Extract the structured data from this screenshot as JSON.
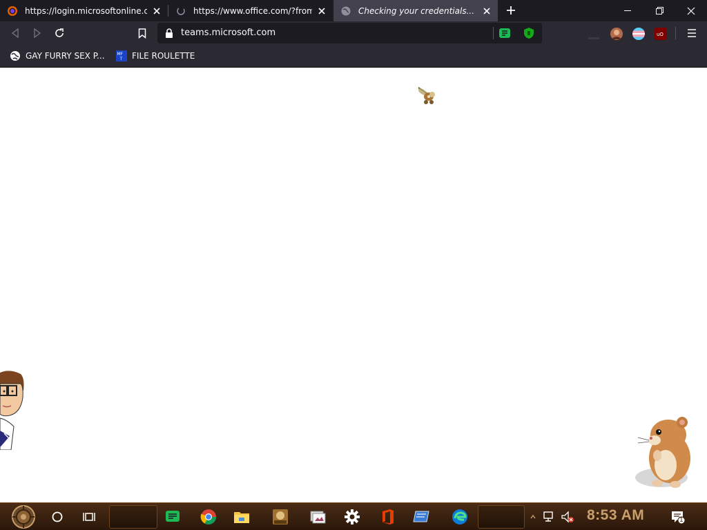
{
  "browser": {
    "tabs": [
      {
        "title": "https://login.microsoftonline.com",
        "active": false,
        "favicon": "firefox-icon"
      },
      {
        "title": "https://www.office.com/?from=",
        "active": false,
        "favicon": "loading-icon"
      },
      {
        "title": "Checking your credentials...",
        "active": true,
        "favicon": "globe-icon"
      }
    ],
    "address": "teams.microsoft.com"
  },
  "bookmarks": [
    {
      "label": "GAY FURRY SEX P...",
      "icon": "globe-icon"
    },
    {
      "label": "FILE ROULETTE",
      "icon": "mft-icon"
    }
  ],
  "taskbar": {
    "pinned": [
      "start-orb",
      "cortana-circle",
      "task-view",
      "spotify",
      "chrome",
      "file-explorer",
      "game-app",
      "image-viewer",
      "settings",
      "office",
      "remote-desktop",
      "edge"
    ],
    "clock": "8:53 AM",
    "notification_count": "1"
  },
  "colors": {
    "tab_bg": "#1c1b22",
    "toolbar_bg": "#2b2a33",
    "active_tab": "#42414d",
    "taskbar_text": "#c9a06b"
  }
}
